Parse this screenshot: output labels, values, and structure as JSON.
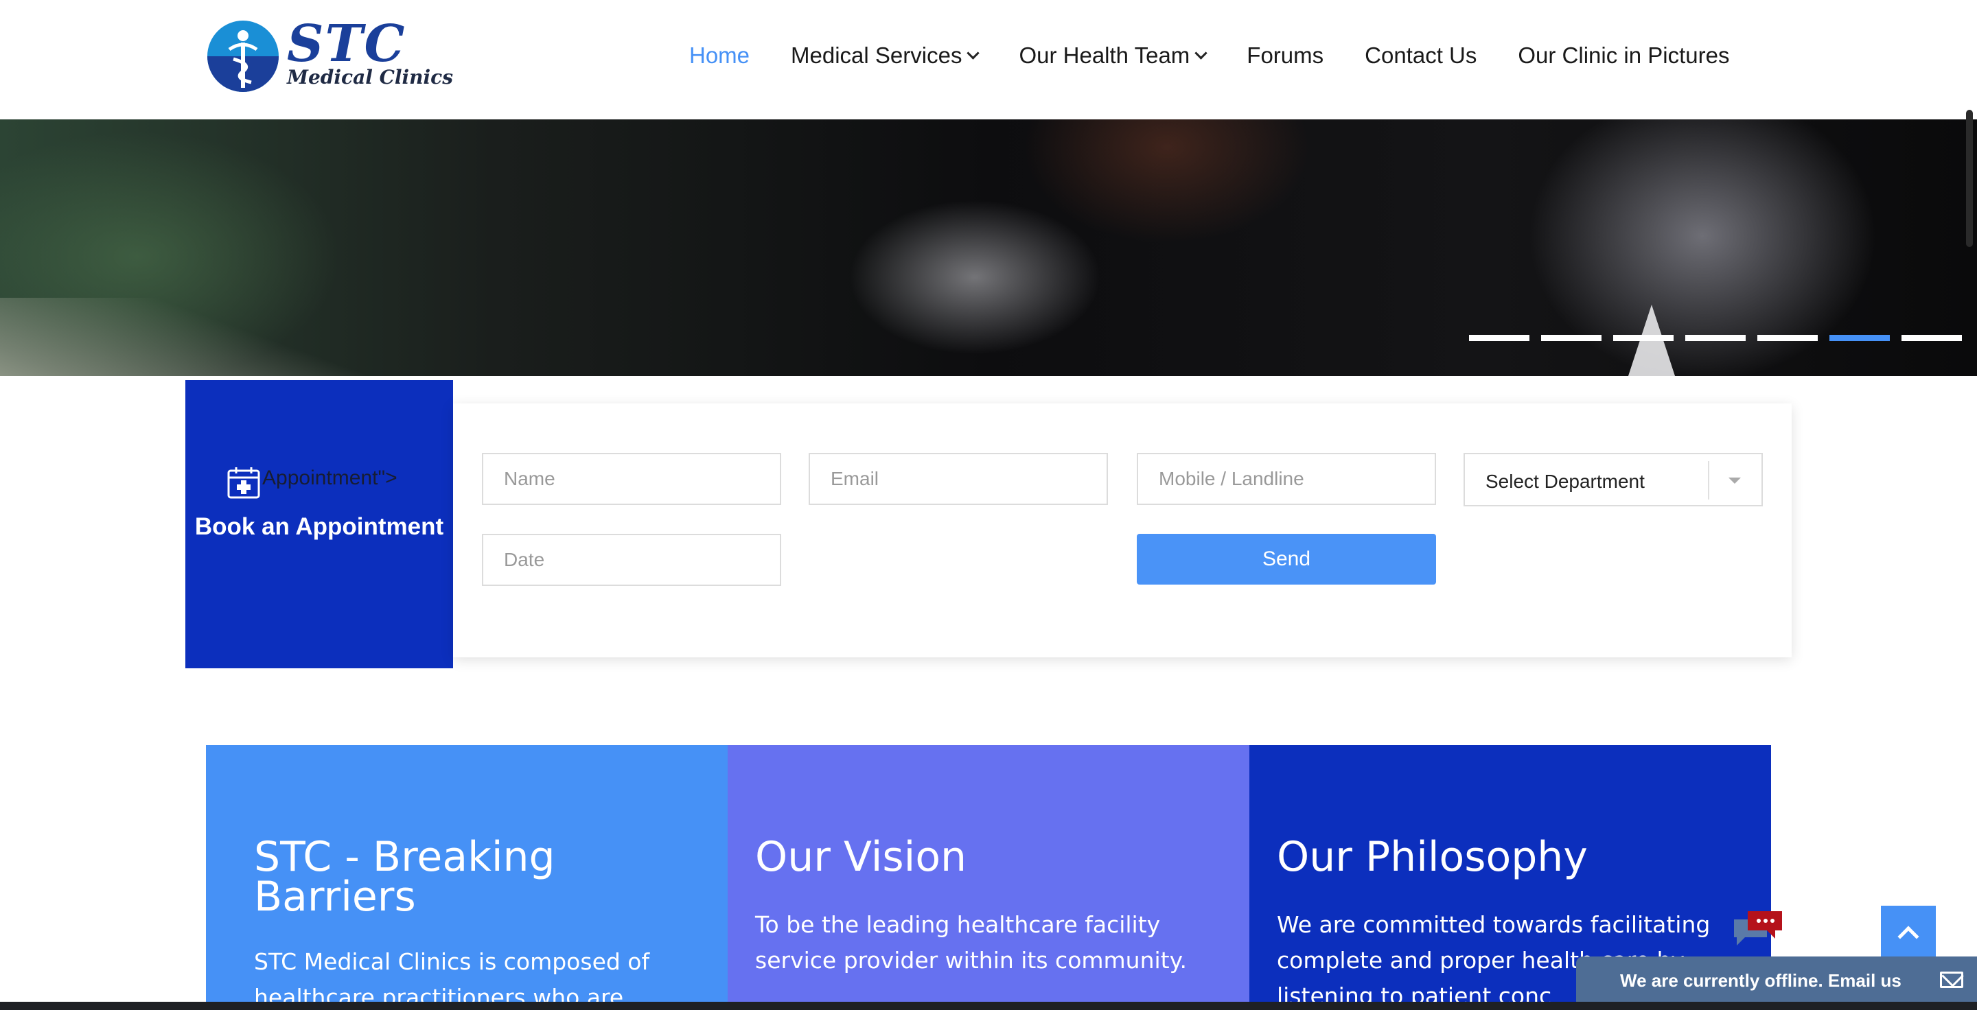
{
  "brand": {
    "logo_main": "STC",
    "logo_sub": "Medical Clinics",
    "colors": {
      "primary": "#0c2fbd",
      "accent": "#4691f6",
      "violet": "#6671f0"
    }
  },
  "nav": {
    "items": [
      {
        "label": "Home",
        "active": true
      },
      {
        "label": "Medical Services",
        "has_dropdown": true
      },
      {
        "label": "Our Health Team",
        "has_dropdown": true
      },
      {
        "label": "Forums"
      },
      {
        "label": "Contact Us"
      },
      {
        "label": "Our Clinic in Pictures"
      }
    ]
  },
  "hero": {
    "slide_count": 7,
    "active_slide": 6
  },
  "appointment": {
    "icon": "calendar-plus-icon",
    "icon_label": "Appointment\">",
    "heading": "Book an Appointment",
    "fields": {
      "name_placeholder": "Name",
      "email_placeholder": "Email",
      "phone_placeholder": "Mobile / Landline",
      "date_placeholder": "Date",
      "department_selected": "Select Department"
    },
    "send_label": "Send"
  },
  "cards": [
    {
      "title": "STC - Breaking Barriers",
      "text": "STC Medical Clinics is composed of healthcare practitioners who are"
    },
    {
      "title": "Our Vision",
      "text": "To be the leading healthcare facility service provider within its community."
    },
    {
      "title": "Our Philosophy",
      "text": "We are committed towards facilitating complete and proper health care by listening to patient conc"
    }
  ],
  "widgets": {
    "chat_icon": "chat-bubbles-icon",
    "back_to_top_icon": "chevron-up-icon",
    "offline_text": "We are currently offline. Email us",
    "offline_icon": "mail-icon"
  }
}
